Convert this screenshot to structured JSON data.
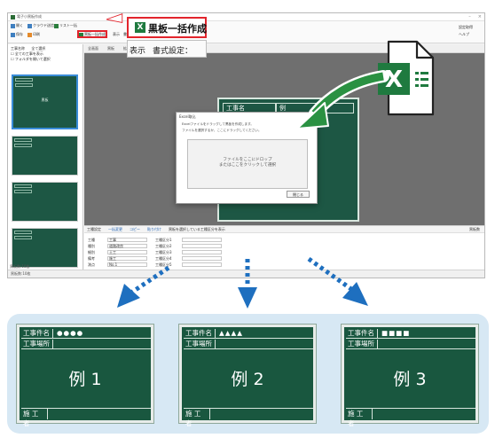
{
  "colors": {
    "accent_red": "#e2242c",
    "board_green": "#19573f",
    "excel_green": "#1f7a3f",
    "arrow_blue": "#1e6fbf",
    "panel_bg": "#d7e8f4"
  },
  "app": {
    "title": "電子小黒板作成",
    "ribbon": {
      "btn1": "開く",
      "btn2": "クラウド送信",
      "btn3": "リスト一括",
      "btn4": "黒板一括作成",
      "btn5": "保存",
      "btn6": "印刷",
      "btn7": "表示",
      "btn8": "書式設定",
      "right1": "設定取得",
      "right2": "ヘルプ"
    },
    "left_pane": {
      "label1": "工事名称",
      "label2": "全て選択",
      "check1": "全ての工事を表示",
      "check2": "フォルダを開いて選択",
      "selected_thumb_label": "黒板",
      "thumb_label": "工事件名",
      "status": "黒板数:10枚"
    },
    "canvas": {
      "tool1": "全画面",
      "tool2": "黒板",
      "tool3": "拡大",
      "tool4": "縮小",
      "board_label": "工事名",
      "board_value": "例"
    },
    "dialog": {
      "title": "Excel取込",
      "text1": "Excelファイルをドラッグして黒板を作成します。",
      "text2": "ファイルを選択するか、ここにドラッグしてください。",
      "dropzone_line1": "ファイルをここにドロップ",
      "dropzone_line2": "またはここをクリックして選択",
      "close": "閉じる"
    },
    "props": {
      "tab1": "工種設定",
      "tab2": "一括変更",
      "tab3": "コピー",
      "tab4": "貼り付け",
      "tab5": "黒板を選択している工種区分を表示",
      "right_label": "黒板数",
      "rows": [
        {
          "label": "工種",
          "value": "工事"
        },
        {
          "label": "種別",
          "value": "道路改良"
        },
        {
          "label": "細別",
          "value": "土工"
        },
        {
          "label": "備考",
          "value": "施工"
        },
        {
          "label": "測点",
          "value": "No.1"
        }
      ],
      "rows2": [
        {
          "label": "工種区分1",
          "value": ""
        },
        {
          "label": "工種区分2",
          "value": ""
        },
        {
          "label": "工種区分3",
          "value": ""
        },
        {
          "label": "工種区分4",
          "value": ""
        },
        {
          "label": "工種区分5",
          "value": ""
        }
      ]
    },
    "statusbar": "黒板数:10枚"
  },
  "callout": {
    "icon": "excel-icon",
    "title": "黒板一括作成",
    "sub1": "表示",
    "sub2": "書式設定："
  },
  "excel_badge": {
    "letter": "X"
  },
  "examples": [
    {
      "row1_label": "工事件名",
      "row1_value": "●●●●",
      "row2_label": "工事場所",
      "center": "例 1",
      "footer_label": "施 工 者"
    },
    {
      "row1_label": "工事件名",
      "row1_value": "▲▲▲▲",
      "row2_label": "工事場所",
      "center": "例 2",
      "footer_label": "施 工 者"
    },
    {
      "row1_label": "工事件名",
      "row1_value": "■■■■",
      "row2_label": "工事場所",
      "center": "例 3",
      "footer_label": "施 工 者"
    }
  ]
}
